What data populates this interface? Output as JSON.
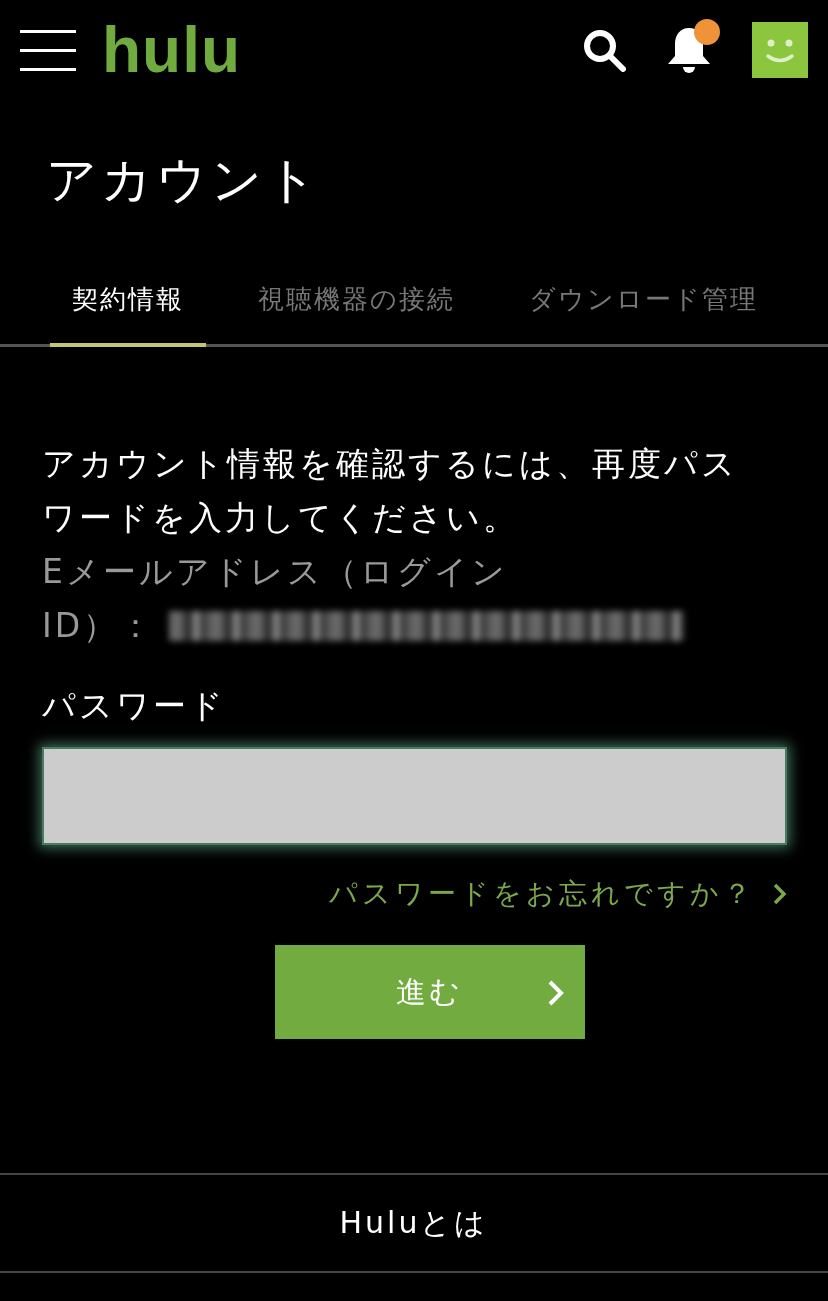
{
  "header": {
    "logo": "hulu",
    "notification_badge": true
  },
  "title": "アカウント",
  "tabs": [
    {
      "label": "契約情報",
      "selected": true
    },
    {
      "label": "視聴機器の接続",
      "selected": false
    },
    {
      "label": "ダウンロード管理",
      "selected": false
    }
  ],
  "message": "アカウント情報を確認するには、再度パスワードを入力してください。",
  "email_label_lines": [
    "Eメールアドレス（ログイン",
    "ID）："
  ],
  "password": {
    "label": "パスワード"
  },
  "forgot_link": "パスワードをお忘れですか？",
  "submit_button": "進む",
  "footer": {
    "link": "Huluとは"
  }
}
